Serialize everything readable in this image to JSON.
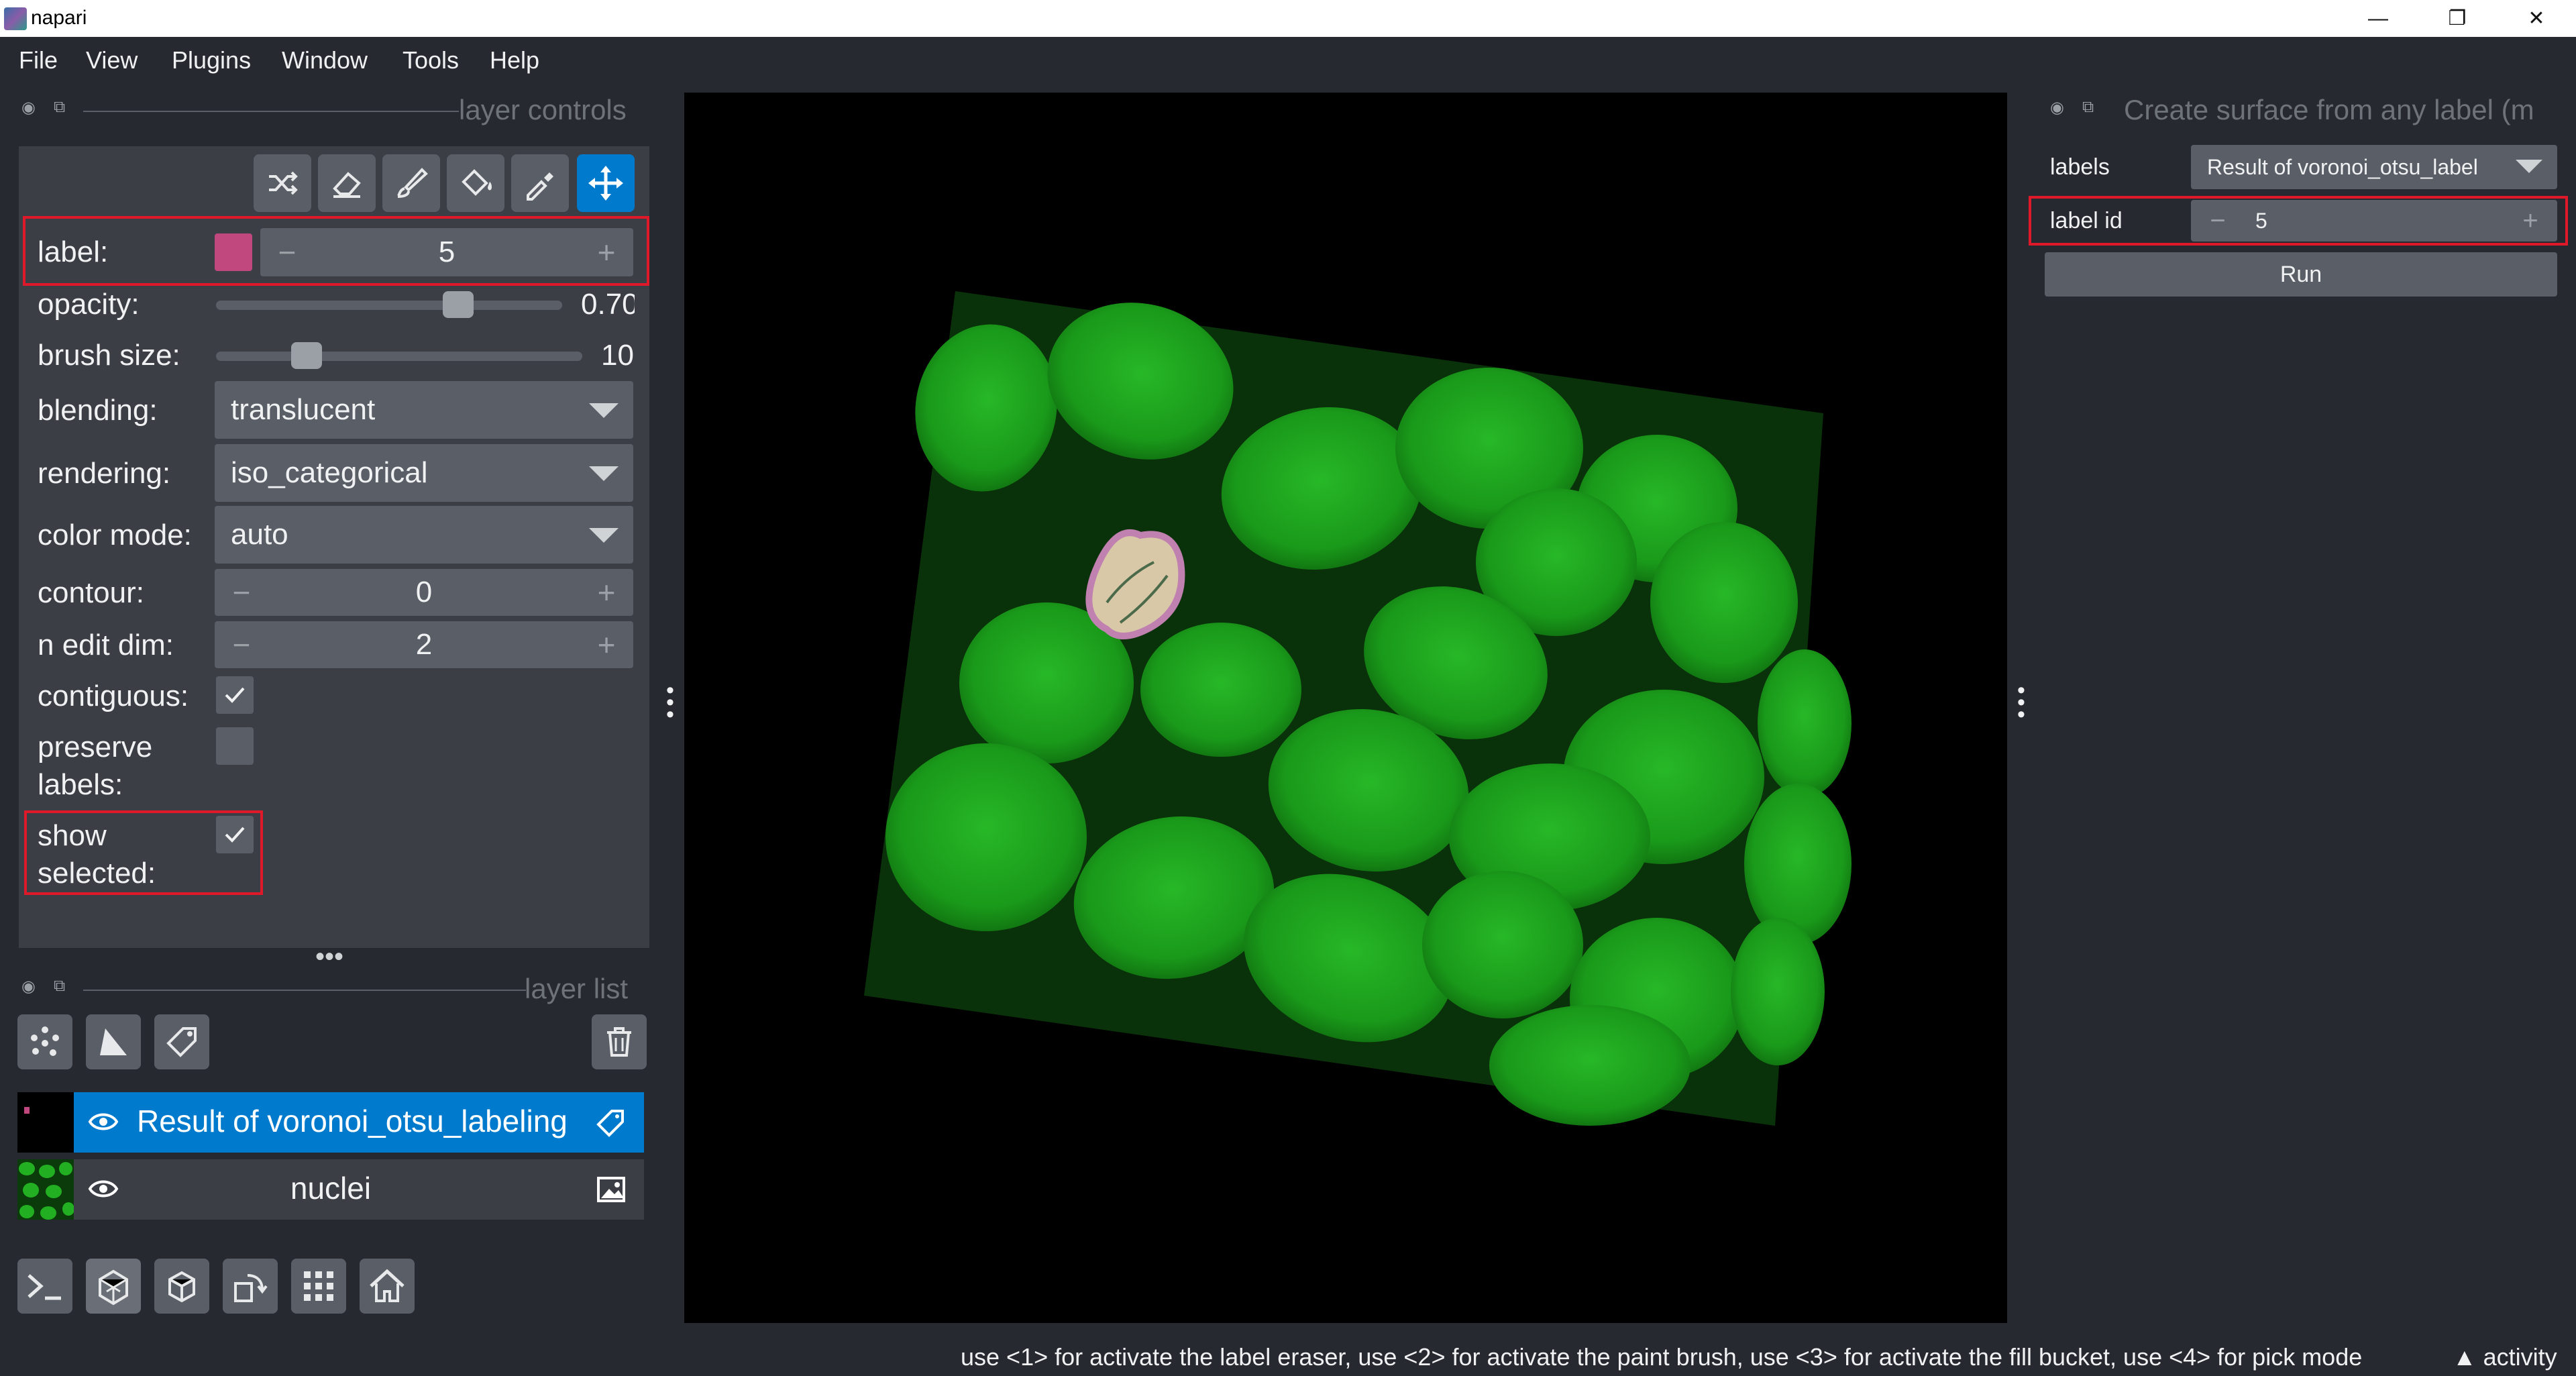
{
  "window": {
    "title": "napari",
    "controls": [
      "—",
      "❐",
      "✕"
    ]
  },
  "menu": [
    "File",
    "View",
    "Plugins",
    "Window",
    "Tools",
    "Help"
  ],
  "layer_controls": {
    "header": "layer controls",
    "label_caption": "label:",
    "label_value": "5",
    "label_color": "#c0487e",
    "opacity_caption": "opacity:",
    "opacity_value": "0.70",
    "opacity_fraction": 0.7,
    "brush_caption": "brush size:",
    "brush_value": "10",
    "blending_caption": "blending:",
    "blending_value": "translucent",
    "rendering_caption": "rendering:",
    "rendering_value": "iso_categorical",
    "colormode_caption": "color mode:",
    "colormode_value": "auto",
    "contour_caption": "contour:",
    "contour_value": "0",
    "nedit_caption": "n edit dim:",
    "nedit_value": "2",
    "contiguous_caption": "contiguous:",
    "contiguous_checked": true,
    "preserve_caption_1": "preserve",
    "preserve_caption_2": "labels:",
    "preserve_checked": false,
    "show_caption_1": "show",
    "show_caption_2": "selected:",
    "show_checked": true,
    "tools": [
      "shuffle-icon",
      "eraser-icon",
      "paint-brush-icon",
      "fill-bucket-icon",
      "color-picker-icon",
      "pan-zoom-icon"
    ],
    "active_tool": "pan-zoom-icon"
  },
  "layer_list": {
    "header": "layer list",
    "layers": [
      {
        "name": "Result of voronoi_otsu_labeling",
        "type": "labels",
        "selected": true
      },
      {
        "name": "nuclei",
        "type": "image",
        "selected": false
      }
    ]
  },
  "plugin_panel": {
    "header": "Create surface from any label (m",
    "labels_caption": "labels",
    "labels_value": "Result of voronoi_otsu_label",
    "labelid_caption": "label id",
    "labelid_value": "5",
    "run_label": "Run"
  },
  "status": {
    "message": "use <1> for activate the label eraser, use <2> for activate the paint brush, use <3> for activate the fill bucket, use <4> for pick mode",
    "activity": "activity"
  },
  "colors": {
    "background": "#262930",
    "panel": "#3b3e45",
    "widget": "#5a5e66",
    "accent": "#007acc",
    "highlight": "#e0192a",
    "nuclei": "#1fa51f"
  }
}
